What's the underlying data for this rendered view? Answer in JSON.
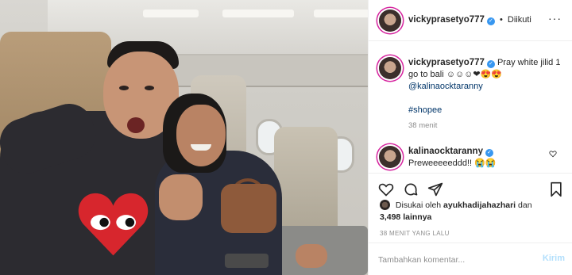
{
  "post_header": {
    "username": "vickyprasetyo777",
    "follow_status": "Diikuti",
    "separator": "•"
  },
  "caption": {
    "username": "vickyprasetyo777",
    "text": "Pray white jilid 1 go to bali",
    "emojis": "☺☺☺❤😍😍",
    "mention": "@kalinaocktaranny",
    "hashtag": "#shopee",
    "time": "38 menit"
  },
  "comment": {
    "username": "kalinaocktaranny",
    "text": "Preweeeeeddd!!",
    "emojis": "😭😭"
  },
  "likes": {
    "prefix": "Disukai oleh",
    "user": "ayukhadijahazhari",
    "connector": "dan",
    "count": "3,498 lainnya"
  },
  "post_time": "38 MENIT YANG LALU",
  "comment_box": {
    "placeholder": "Tambahkan komentar...",
    "send_label": "Kirim"
  },
  "colors": {
    "accent": "#3897f0",
    "mention": "#003569",
    "muted": "#8e8e8e",
    "send_disabled": "#b2dffc"
  },
  "icons": [
    "more-icon",
    "verified-icon",
    "like-icon",
    "comment-icon",
    "share-icon",
    "save-icon",
    "comment-like-icon"
  ]
}
